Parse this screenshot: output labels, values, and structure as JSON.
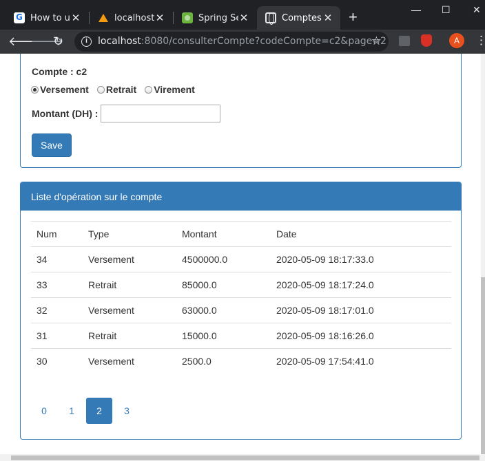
{
  "browser": {
    "tabs": [
      {
        "title": "How to use",
        "favicon": "google-icon",
        "active": false
      },
      {
        "title": "localhost /",
        "favicon": "phpmyadmin-icon",
        "active": false
      },
      {
        "title": "Spring Sec",
        "favicon": "spring-icon",
        "active": false
      },
      {
        "title": "Comptes",
        "favicon": "globe-icon",
        "active": true
      }
    ],
    "url_host": "localhost",
    "url_rest": ":8080/consulterCompte?codeCompte=c2&page=2",
    "avatar_letter": "A"
  },
  "form": {
    "compte_label": "Compte : c2",
    "radio_options": [
      {
        "label": "Versement",
        "checked": true
      },
      {
        "label": "Retrait",
        "checked": false
      },
      {
        "label": "Virement",
        "checked": false
      }
    ],
    "montant_label": "Montant (DH) :",
    "montant_value": "",
    "save_label": "Save"
  },
  "operations": {
    "heading": "Liste d'opération sur le compte",
    "columns": [
      "Num",
      "Type",
      "Montant",
      "Date"
    ],
    "rows": [
      [
        "34",
        "Versement",
        "4500000.0",
        "2020-05-09 18:17:33.0"
      ],
      [
        "33",
        "Retrait",
        "85000.0",
        "2020-05-09 18:17:24.0"
      ],
      [
        "32",
        "Versement",
        "63000.0",
        "2020-05-09 18:17:01.0"
      ],
      [
        "31",
        "Retrait",
        "15000.0",
        "2020-05-09 18:16:26.0"
      ],
      [
        "30",
        "Versement",
        "2500.0",
        "2020-05-09 17:54:41.0"
      ]
    ],
    "pages": [
      "0",
      "1",
      "2",
      "3"
    ],
    "current_page": "2"
  },
  "colors": {
    "primary": "#337ab7",
    "chrome_dark": "#202124",
    "chrome_toolbar": "#35363a"
  }
}
